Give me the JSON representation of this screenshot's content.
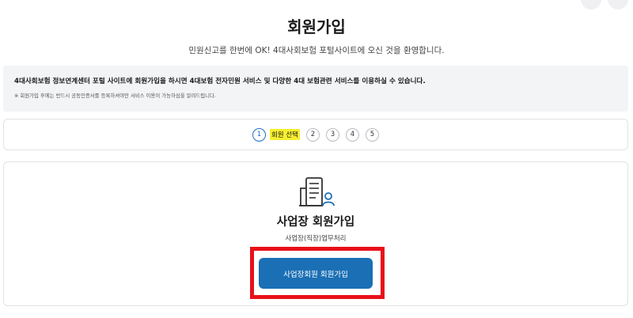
{
  "header": {
    "title": "회원가입",
    "subtitle": "민원신고를 한번에 OK! 4대사회보험 포털사이트에 오신 것을 환영합니다."
  },
  "notice": {
    "main": "4대사회보험 정보연계센터 포털 사이트에 회원가입을 하시면 4대보험 전자민원 서비스 및 다양한 4대 보험관련 서비스를 이용하실 수 있습니다.",
    "sub": "※ 회원가입 후에는 반드시 공동인증서를 등록하셔야만 서비스 이용이 가능하심을 알려드립니다."
  },
  "steps": {
    "items": [
      {
        "number": "1",
        "label": "회원 선택",
        "active": true
      },
      {
        "number": "2"
      },
      {
        "number": "3"
      },
      {
        "number": "4"
      },
      {
        "number": "5"
      }
    ]
  },
  "card": {
    "icon": "building-user-icon",
    "title": "사업장 회원가입",
    "description": "사업장(직장)업무처리",
    "button_label": "사업장회원 회원가입"
  },
  "colors": {
    "primary": "#1a6fb5",
    "highlight": "#f7ef2e",
    "annotation": "#e8101a"
  }
}
